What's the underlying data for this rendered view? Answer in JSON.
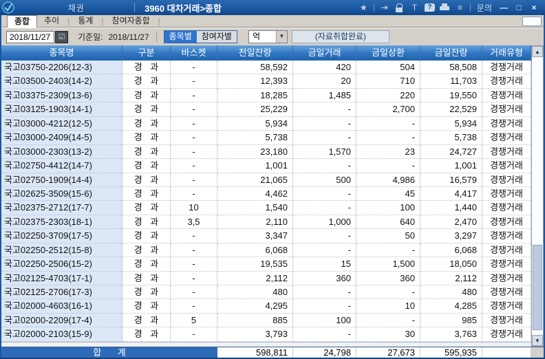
{
  "window": {
    "category": "채권",
    "title": "3960 대차거래>종합",
    "inquiry": "문의",
    "titlebar_icons": [
      {
        "name": "favorite-star-icon",
        "glyph": "★"
      },
      {
        "name": "export-icon",
        "glyph": "⇥"
      },
      {
        "name": "lock-icon",
        "glyph": ""
      },
      {
        "name": "font-size-icon",
        "glyph": "T"
      },
      {
        "name": "help-balloon-icon",
        "glyph": "?"
      },
      {
        "name": "printer-icon",
        "glyph": ""
      },
      {
        "name": "menu-list-icon",
        "glyph": "≡"
      }
    ],
    "window_controls": [
      {
        "name": "minimize-button",
        "glyph": "—"
      },
      {
        "name": "maximize-button",
        "glyph": "□"
      },
      {
        "name": "close-button",
        "glyph": "×"
      }
    ]
  },
  "tabs": [
    {
      "name": "tab-summary",
      "label": "종합",
      "active": true
    },
    {
      "name": "tab-trend",
      "label": "추이",
      "active": false
    },
    {
      "name": "tab-statistics",
      "label": "통계",
      "active": false
    },
    {
      "name": "tab-participant-summary",
      "label": "참여자종합",
      "active": false
    }
  ],
  "toolbar": {
    "date_value": "2018/11/27",
    "base_date_label": "기준일:",
    "base_date_value": "2018/11/27",
    "view_toggle": [
      {
        "name": "view-by-item-button",
        "label": "종목별",
        "selected": true
      },
      {
        "name": "view-by-participant-button",
        "label": "참여자별",
        "selected": false
      }
    ],
    "unit_value": "억",
    "status_text": "(자료취합완료)"
  },
  "glyphs": {
    "calendar_check": "☑",
    "dropdown_arrow": "▼",
    "scroll_up": "▲",
    "scroll_down": "▼"
  },
  "table": {
    "columns": [
      {
        "key": "name",
        "label": "종목명"
      },
      {
        "key": "gubun",
        "label": "구분"
      },
      {
        "key": "basket",
        "label": "바스켓"
      },
      {
        "key": "prev-balance",
        "label": "전일잔량"
      },
      {
        "key": "today-trade",
        "label": "금일거래"
      },
      {
        "key": "today-repay",
        "label": "금일상환"
      },
      {
        "key": "today-balance",
        "label": "금일잔량"
      },
      {
        "key": "trade-type",
        "label": "거래유형"
      }
    ],
    "rows": [
      [
        "국고03750-2206(12-3)",
        "경 과",
        "-",
        "58,592",
        "420",
        "504",
        "58,508",
        "경쟁거래"
      ],
      [
        "국고03500-2403(14-2)",
        "경 과",
        "-",
        "12,393",
        "20",
        "710",
        "11,703",
        "경쟁거래"
      ],
      [
        "국고03375-2309(13-6)",
        "경 과",
        "-",
        "18,285",
        "1,485",
        "220",
        "19,550",
        "경쟁거래"
      ],
      [
        "국고03125-1903(14-1)",
        "경 과",
        "-",
        "25,229",
        "-",
        "2,700",
        "22,529",
        "경쟁거래"
      ],
      [
        "국고03000-4212(12-5)",
        "경 과",
        "-",
        "5,934",
        "-",
        "-",
        "5,934",
        "경쟁거래"
      ],
      [
        "국고03000-2409(14-5)",
        "경 과",
        "-",
        "5,738",
        "-",
        "-",
        "5,738",
        "경쟁거래"
      ],
      [
        "국고03000-2303(13-2)",
        "경 과",
        "-",
        "23,180",
        "1,570",
        "23",
        "24,727",
        "경쟁거래"
      ],
      [
        "국고02750-4412(14-7)",
        "경 과",
        "-",
        "1,001",
        "-",
        "-",
        "1,001",
        "경쟁거래"
      ],
      [
        "국고02750-1909(14-4)",
        "경 과",
        "-",
        "21,065",
        "500",
        "4,986",
        "16,579",
        "경쟁거래"
      ],
      [
        "국고02625-3509(15-6)",
        "경 과",
        "-",
        "4,462",
        "-",
        "45",
        "4,417",
        "경쟁거래"
      ],
      [
        "국고02375-2712(17-7)",
        "경 과",
        "10",
        "1,540",
        "-",
        "100",
        "1,440",
        "경쟁거래"
      ],
      [
        "국고02375-2303(18-1)",
        "경 과",
        "3,5",
        "2,110",
        "1,000",
        "640",
        "2,470",
        "경쟁거래"
      ],
      [
        "국고02250-3709(17-5)",
        "경 과",
        "-",
        "3,347",
        "-",
        "50",
        "3,297",
        "경쟁거래"
      ],
      [
        "국고02250-2512(15-8)",
        "경 과",
        "-",
        "6,068",
        "-",
        "-",
        "6,068",
        "경쟁거래"
      ],
      [
        "국고02250-2506(15-2)",
        "경 과",
        "-",
        "19,535",
        "15",
        "1,500",
        "18,050",
        "경쟁거래"
      ],
      [
        "국고02125-4703(17-1)",
        "경 과",
        "-",
        "2,112",
        "360",
        "360",
        "2,112",
        "경쟁거래"
      ],
      [
        "국고02125-2706(17-3)",
        "경 과",
        "-",
        "480",
        "-",
        "-",
        "480",
        "경쟁거래"
      ],
      [
        "국고02000-4603(16-1)",
        "경 과",
        "-",
        "4,295",
        "-",
        "10",
        "4,285",
        "경쟁거래"
      ],
      [
        "국고02000-2209(17-4)",
        "경 과",
        "5",
        "885",
        "100",
        "-",
        "985",
        "경쟁거래"
      ],
      [
        "국고02000-2103(15-9)",
        "경 과",
        "-",
        "3,793",
        "-",
        "30",
        "3,763",
        "경쟁거래"
      ]
    ],
    "total": {
      "label": "합 계",
      "prev_balance": "598,811",
      "today_trade": "24,798",
      "today_repay": "27,673",
      "today_balance": "595,935"
    }
  },
  "colors": {
    "titlebar_blue": "#1b57a0",
    "header_blue": "#2f74c0",
    "selected_button_blue": "#2e74d0",
    "first_column_bg": "#dbe7f6",
    "total_label_bg": "#2d6ab9"
  }
}
